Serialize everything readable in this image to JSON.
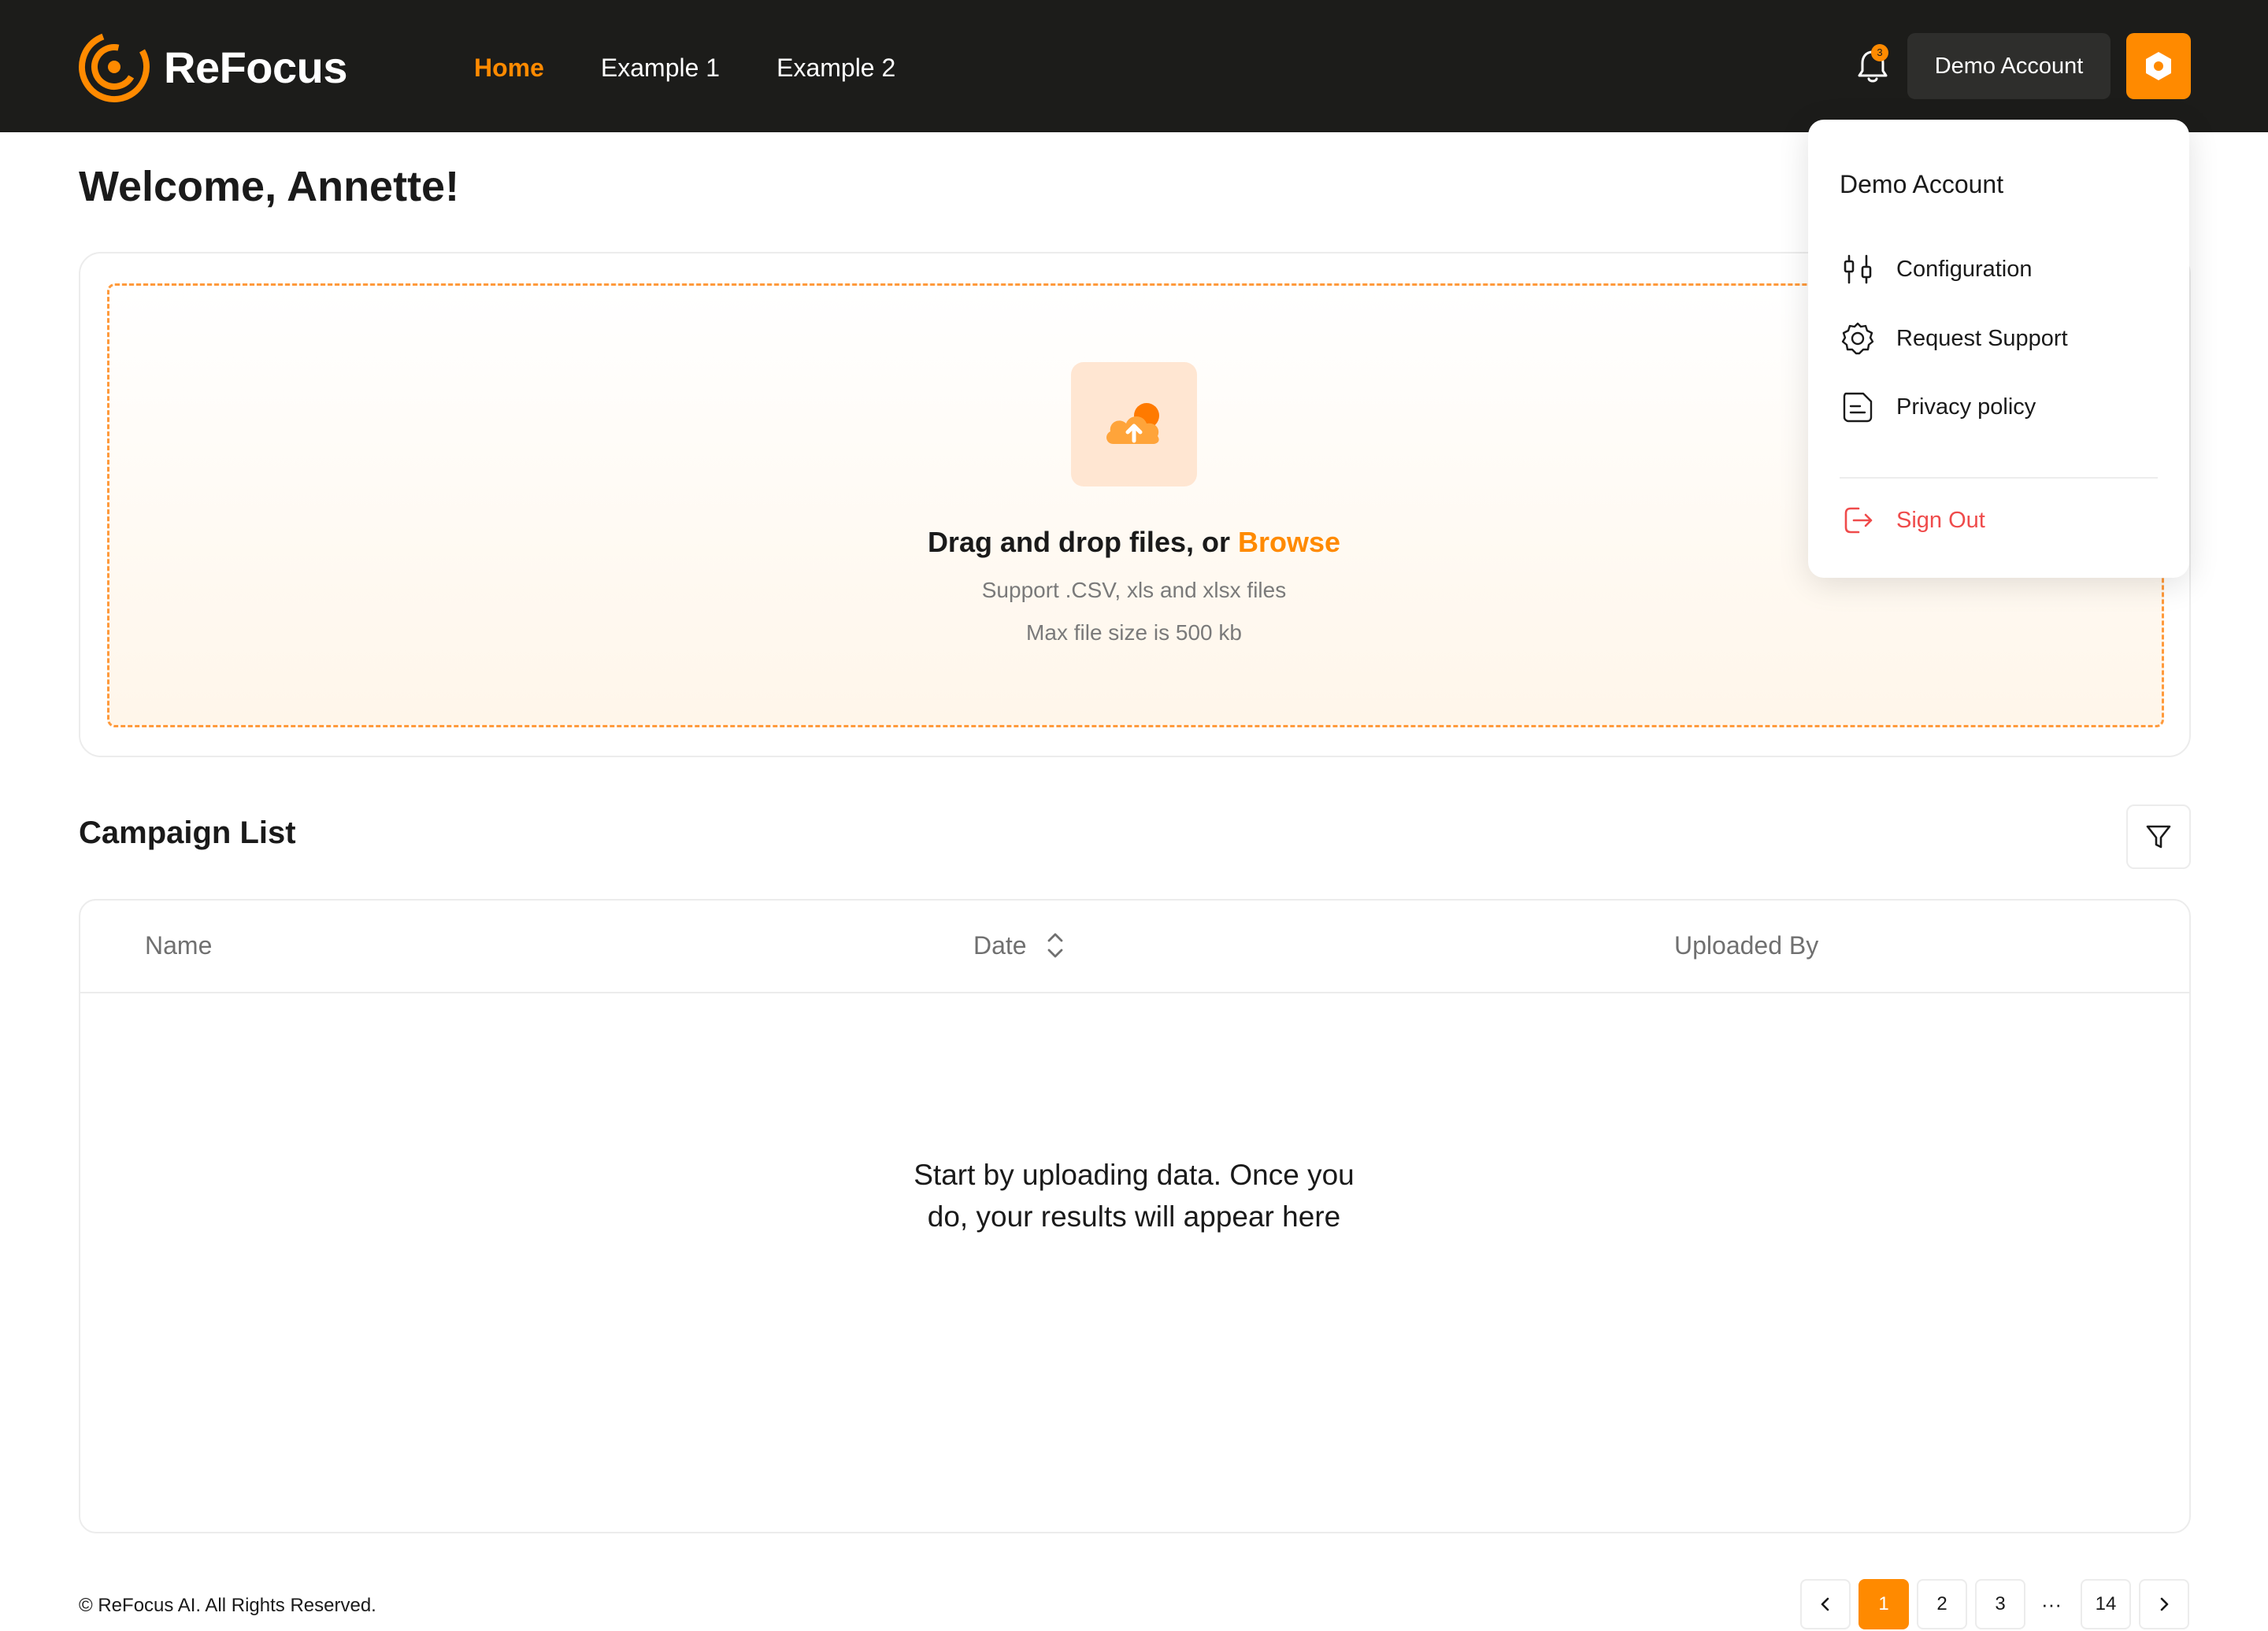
{
  "header": {
    "brand": "ReFocus",
    "nav": [
      {
        "label": "Home",
        "active": true
      },
      {
        "label": "Example 1",
        "active": false
      },
      {
        "label": "Example 2",
        "active": false
      }
    ],
    "notification_count": "3",
    "account_label": "Demo Account",
    "accent_color": "#ff8a00"
  },
  "page": {
    "welcome": "Welcome, Annette!"
  },
  "upload": {
    "title_prefix": "Drag and drop files, or ",
    "browse": "Browse",
    "support_text": "Support .CSV, xls and xlsx files",
    "max_size_text": "Max file size is 500 kb"
  },
  "campaign": {
    "title": "Campaign List",
    "columns": [
      "Name",
      "Date",
      "Uploaded By"
    ],
    "empty_message": "Start by uploading data. Once you do, your results will appear here"
  },
  "footer": {
    "copyright": "© ReFocus AI. All Rights Reserved."
  },
  "pagination": {
    "pages": [
      "1",
      "2",
      "3"
    ],
    "ellipsis": "···",
    "last_page": "14",
    "current": "1"
  },
  "account_menu": {
    "title": "Demo Account",
    "items": [
      {
        "label": "Configuration",
        "icon": "sliders-icon"
      },
      {
        "label": "Request Support",
        "icon": "gear-icon"
      },
      {
        "label": "Privacy policy",
        "icon": "document-icon"
      }
    ],
    "sign_out": "Sign Out"
  }
}
